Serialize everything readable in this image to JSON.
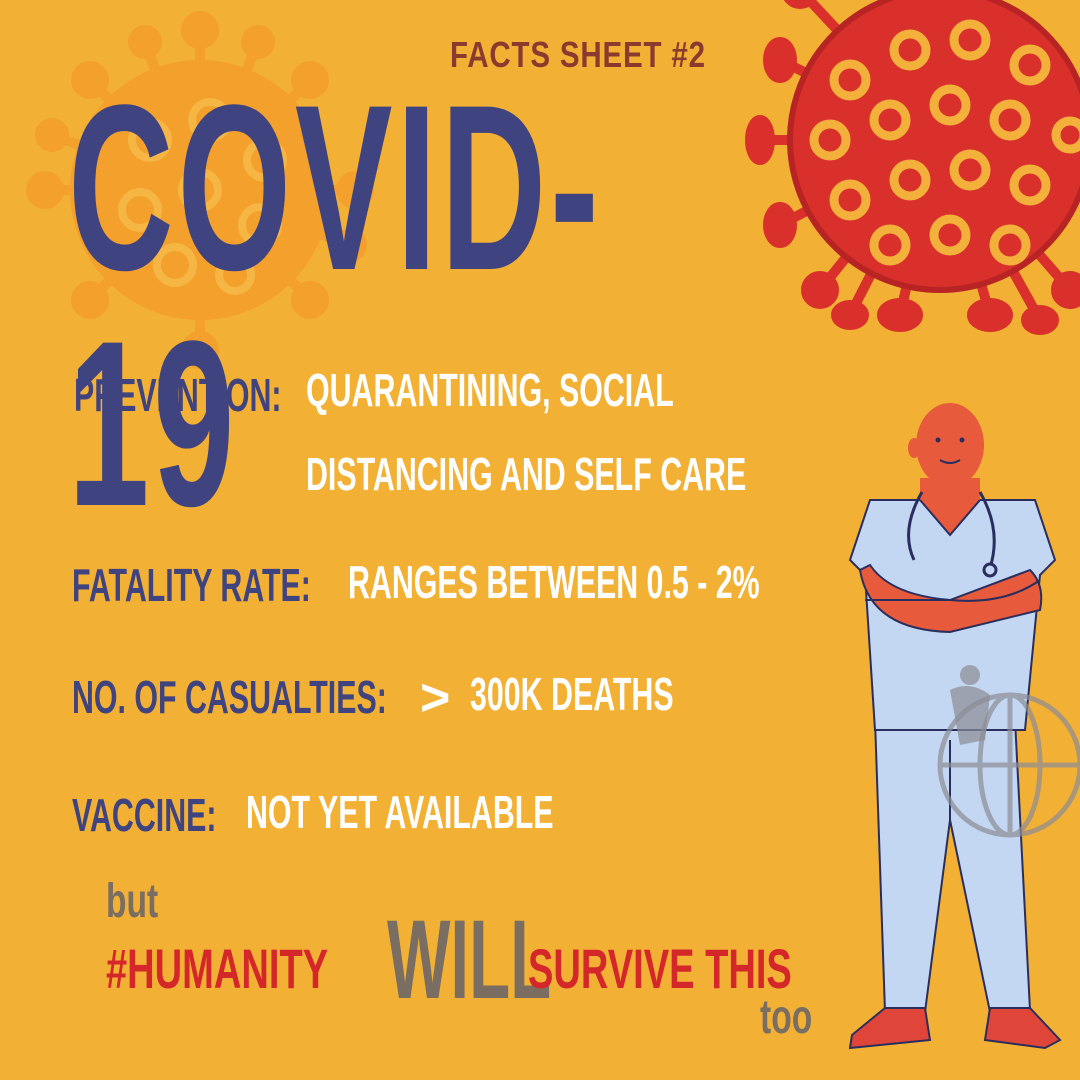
{
  "header": {
    "sheet_label": "FACTS SHEET #2",
    "title": "COVID-19"
  },
  "facts": [
    {
      "label": "PREVENTION:",
      "value_line1": "QUARANTINING, SOCIAL",
      "value_line2": "DISTANCING AND SELF CARE"
    },
    {
      "label": "FATALITY RATE:",
      "value": "RANGES BETWEEN 0.5 - 2%"
    },
    {
      "label": "NO. OF CASUALTIES:",
      "value_prefix": ">",
      "value": "300K DEATHS"
    },
    {
      "label": "VACCINE:",
      "value": "NOT YET AVAILABLE"
    }
  ],
  "tagline": {
    "but": "but",
    "hashtag": "#HUMANITY",
    "will": "WILL",
    "survive": "SURVIVE THIS",
    "too": "too"
  },
  "colors": {
    "background": "#F2B134",
    "title_navy": "#3F437F",
    "sheet_label_brown": "#8B3A2E",
    "fact_value_white": "#FFFFFF",
    "tagline_red": "#D4272A",
    "tagline_grey": "#7A6E62",
    "virus_red": "#D9302C",
    "virus_orange": "#F49B2B"
  },
  "icons": [
    "virus-illustration-orange",
    "virus-illustration-red",
    "doctor-illustration",
    "stethoscope-icon",
    "globe-watermark-icon"
  ]
}
